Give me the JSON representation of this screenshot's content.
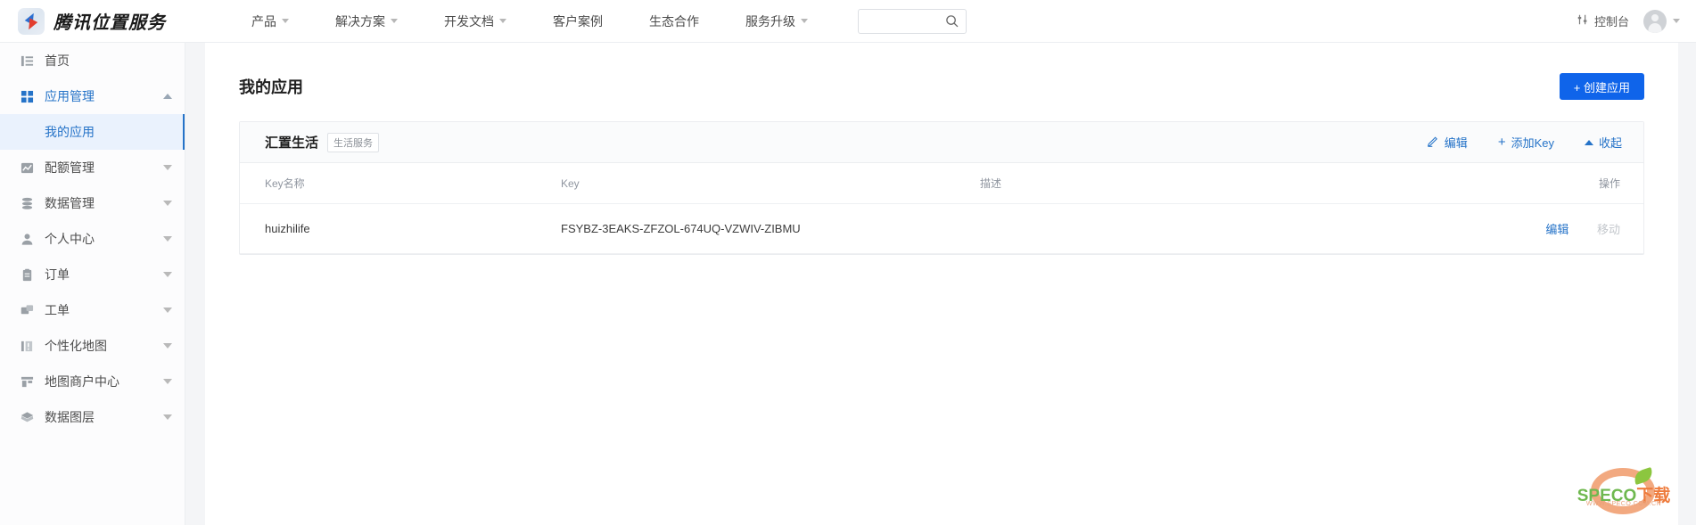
{
  "header": {
    "brand_name": "腾讯位置服务",
    "logo_icon": "compass-icon",
    "nav": [
      {
        "label": "产品",
        "has_caret": true
      },
      {
        "label": "解决方案",
        "has_caret": true
      },
      {
        "label": "开发文档",
        "has_caret": true
      },
      {
        "label": "客户案例",
        "has_caret": false
      },
      {
        "label": "生态合作",
        "has_caret": false
      },
      {
        "label": "服务升级",
        "has_caret": true
      }
    ],
    "search": {
      "value": "",
      "placeholder": "",
      "icon": "search-icon"
    },
    "console_label": "控制台",
    "console_icon": "sliders-icon",
    "avatar_icon": "user-avatar-icon"
  },
  "sidebar": {
    "items": [
      {
        "label": "首页",
        "icon": "home-list-icon",
        "arrow": "none",
        "active": false
      },
      {
        "label": "应用管理",
        "icon": "grid-icon",
        "arrow": "up",
        "active": true
      },
      {
        "label": "配额管理",
        "icon": "chart-icon",
        "arrow": "down",
        "active": false
      },
      {
        "label": "数据管理",
        "icon": "database-icon",
        "arrow": "down",
        "active": false
      },
      {
        "label": "个人中心",
        "icon": "person-icon",
        "arrow": "down",
        "active": false
      },
      {
        "label": "订单",
        "icon": "clipboard-icon",
        "arrow": "down",
        "active": false
      },
      {
        "label": "工单",
        "icon": "ticket-icon",
        "arrow": "down",
        "active": false
      },
      {
        "label": "个性化地图",
        "icon": "map-style-icon",
        "arrow": "down",
        "active": false
      },
      {
        "label": "地图商户中心",
        "icon": "store-icon",
        "arrow": "down",
        "active": false
      },
      {
        "label": "数据图层",
        "icon": "layers-icon",
        "arrow": "down",
        "active": false
      }
    ],
    "submenu_label": "我的应用"
  },
  "main": {
    "page_title": "我的应用",
    "create_button": "+ 创建应用",
    "app_card": {
      "name": "汇置生活",
      "tag": "生活服务",
      "actions": [
        {
          "label": "编辑",
          "icon": "pencil-icon"
        },
        {
          "label": "添加Key",
          "icon": "plus-icon"
        },
        {
          "label": "收起",
          "icon": "caret-up-icon"
        }
      ],
      "table": {
        "columns": [
          "Key名称",
          "Key",
          "描述",
          "操作"
        ],
        "rows": [
          {
            "name": "huizhilife",
            "key": "FSYBZ-3EAKS-ZFZOL-674UQ-VZWIV-ZIBMU",
            "desc": "",
            "ops": [
              {
                "label": "编辑",
                "disabled": false
              },
              {
                "label": "移动",
                "disabled": true
              }
            ]
          }
        ]
      }
    }
  },
  "watermark": {
    "text_en": "SPECO",
    "text_cn": "下载",
    "url": "WWW.SPECO.COM.CN"
  },
  "colors": {
    "accent_blue": "#2573c8",
    "button_blue": "#0f64ea",
    "active_bg": "#eaf2fd",
    "watermark_orange": "#ee7b3c",
    "watermark_green": "#6fb84f"
  }
}
